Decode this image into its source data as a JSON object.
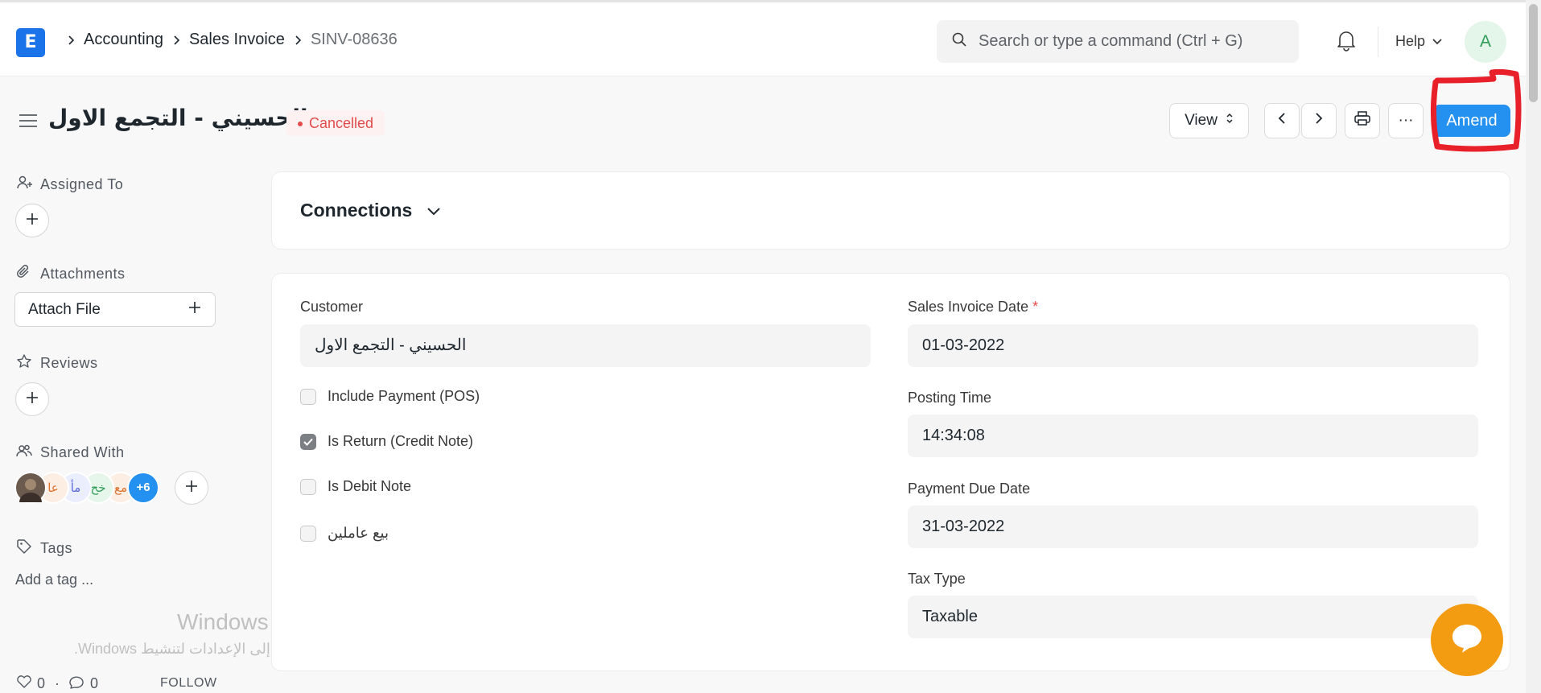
{
  "app": {
    "logo_letter": "E"
  },
  "breadcrumb": {
    "items": [
      "Accounting",
      "Sales Invoice",
      "SINV-08636"
    ]
  },
  "search": {
    "placeholder": "Search or type a command (Ctrl + G)"
  },
  "nav": {
    "help_label": "Help",
    "avatar_initial": "A"
  },
  "page": {
    "title": "الحسيني - التجمع الاول",
    "status": "Cancelled"
  },
  "toolbar": {
    "view_label": "View",
    "more_label": "···",
    "amend_label": "Amend"
  },
  "sidebar": {
    "assigned_to_label": "Assigned To",
    "attachments_label": "Attachments",
    "attach_file_label": "Attach File",
    "reviews_label": "Reviews",
    "shared_with_label": "Shared With",
    "shared_avatars": [
      "عا",
      "مأ",
      "خح",
      "مع"
    ],
    "shared_more": "+6",
    "tags_label": "Tags",
    "add_tag_label": "Add a tag ...",
    "likes": "0",
    "comments": "0",
    "follow_label": "FOLLOW"
  },
  "connections": {
    "title": "Connections"
  },
  "form": {
    "customer_label": "Customer",
    "customer_value": "الحسيني - التجمع الاول",
    "checkboxes": [
      {
        "label": "Include Payment (POS)",
        "checked": false
      },
      {
        "label": "Is Return (Credit Note)",
        "checked": true
      },
      {
        "label": "Is Debit Note",
        "checked": false
      },
      {
        "label": "بيع عاملين",
        "checked": false
      }
    ],
    "invoice_date_label": "Sales Invoice Date",
    "required_mark": "*",
    "invoice_date_value": "01-03-2022",
    "posting_time_label": "Posting Time",
    "posting_time_value": "14:34:08",
    "due_date_label": "Payment Due Date",
    "due_date_value": "31-03-2022",
    "tax_type_label": "Tax Type",
    "tax_type_value": "Taxable"
  },
  "windows_watermark": {
    "line1": "تنشيط Windows",
    "line2": "انتقل إلى الإعدادات لتنشيط Windows."
  },
  "colors": {
    "primary": "#2490ef",
    "status_cancelled": "#e24c4c",
    "annotation": "#e8202a",
    "chat": "#f39c12"
  },
  "icons": [
    "logo-icon",
    "chevron-right-icon",
    "search-icon",
    "bell-icon",
    "chevron-down-icon",
    "menu-icon",
    "sort-icon",
    "chevron-left-icon",
    "printer-icon",
    "user-plus-icon",
    "paperclip-icon",
    "star-icon",
    "users-icon",
    "tag-icon",
    "heart-icon",
    "comment-icon",
    "plus-icon",
    "chat-icon"
  ]
}
